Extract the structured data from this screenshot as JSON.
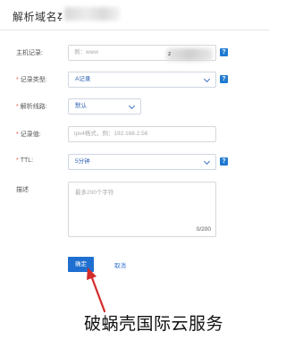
{
  "header": {
    "title": "解析域名：",
    "domain_prefix": "z"
  },
  "form": {
    "host": {
      "label": "主机记录:",
      "placeholder": "例：www",
      "suffix_visible": "z"
    },
    "record_type": {
      "label": "记录类型:",
      "required": "*",
      "value": "A记录"
    },
    "line": {
      "label": "解析线路:",
      "required": "*",
      "value": "默认"
    },
    "record_value": {
      "label": "记录值:",
      "required": "*",
      "placeholder": "ipv4格式，例：192.168.2.56"
    },
    "ttl": {
      "label": "TTL:",
      "required": "*",
      "value": "5分钟"
    },
    "description": {
      "label": "描述",
      "placeholder": "最多200个字符",
      "counter": "0/200"
    },
    "help_icon_glyph": "?"
  },
  "actions": {
    "confirm_label": "确定",
    "cancel_label": "取消"
  },
  "watermark": "破蜗壳国际云服务",
  "colors": {
    "primary": "#1f6fd0",
    "required": "#e9573f",
    "help_icon": "#1f7ad1",
    "arrow": "#d42a2a"
  }
}
